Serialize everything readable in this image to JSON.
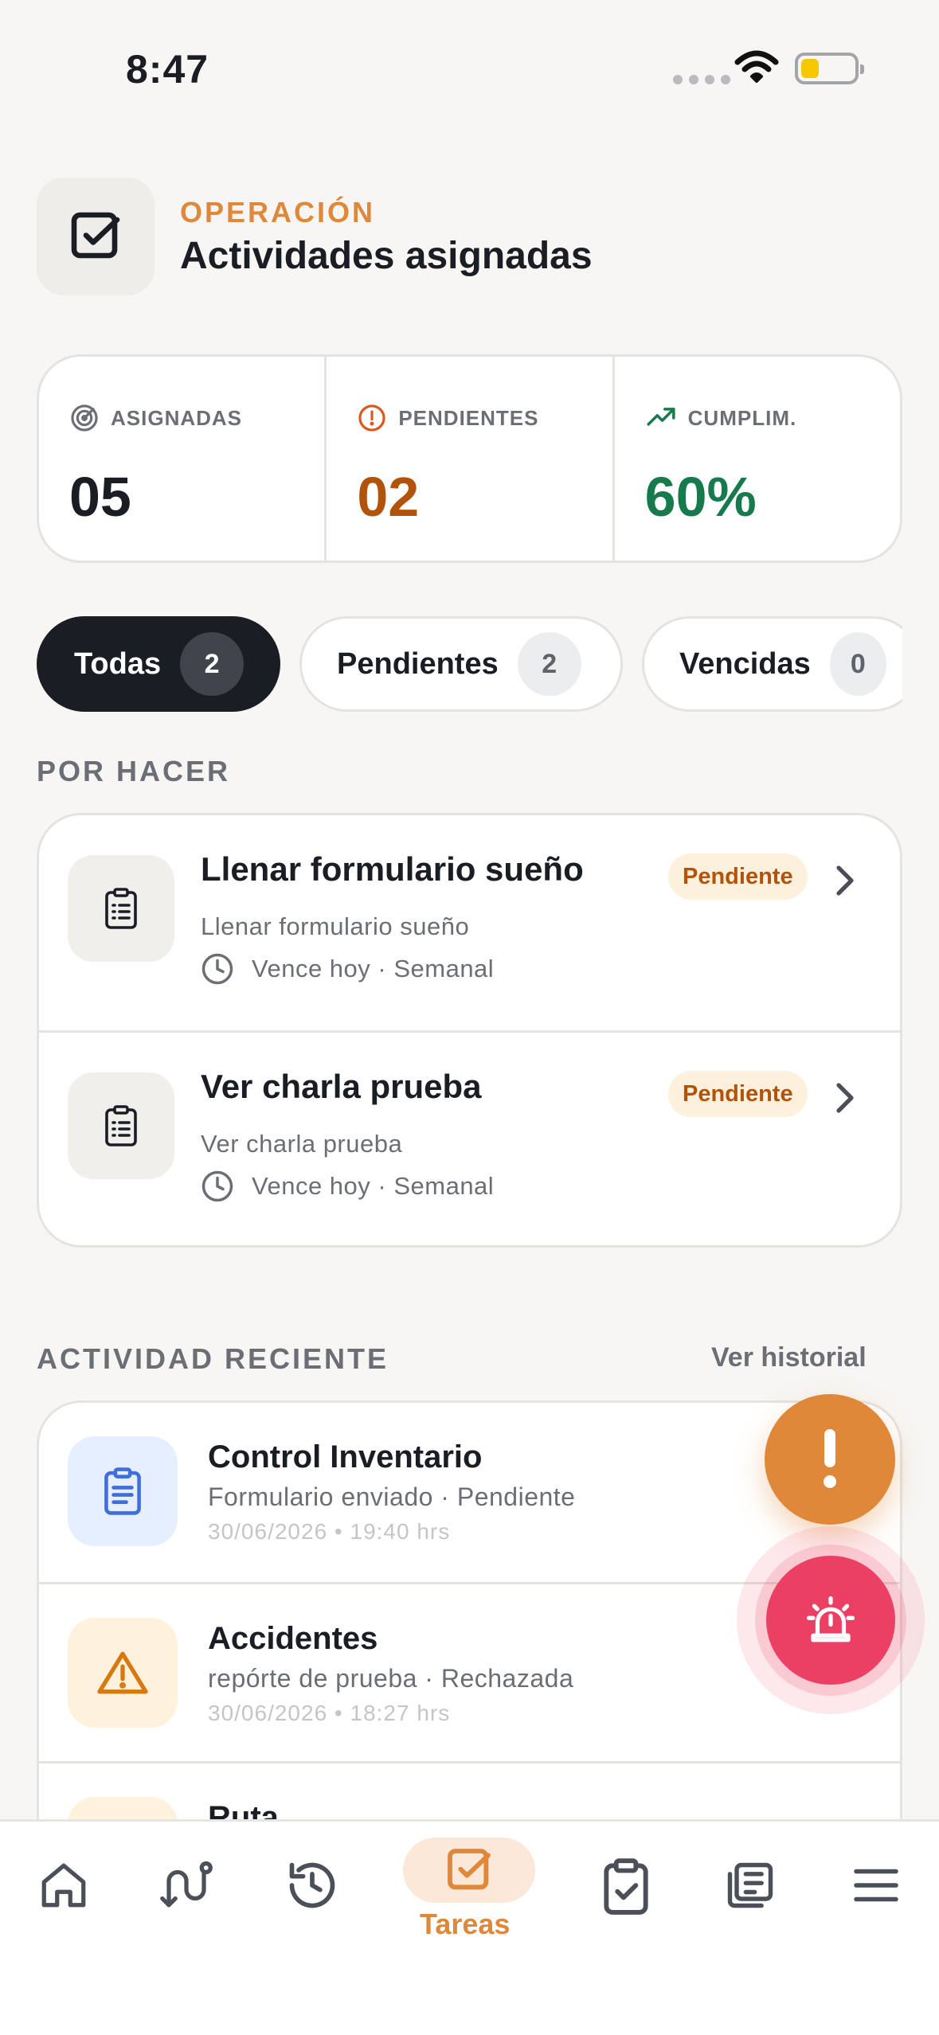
{
  "status_bar": {
    "time": "8:47"
  },
  "header": {
    "eyebrow": "OPERACIÓN",
    "title": "Actividades asignadas"
  },
  "stats": [
    {
      "label": "ASIGNADAS",
      "value": "05",
      "color": "#1a1d24",
      "icon": "target-icon"
    },
    {
      "label": "PENDIENTES",
      "value": "02",
      "color": "#b2530c",
      "icon": "alert-circle-icon"
    },
    {
      "label": "CUMPLIM.",
      "value": "60%",
      "color": "#177a4d",
      "icon": "trending-up-icon"
    }
  ],
  "tabs": [
    {
      "label": "Todas",
      "count": "2"
    },
    {
      "label": "Pendientes",
      "count": "2"
    },
    {
      "label": "Vencidas",
      "count": "0"
    }
  ],
  "todo": {
    "section_title": "POR HACER",
    "items": [
      {
        "title": "Llenar formulario sueño",
        "subtitle": "Llenar formulario sueño",
        "meta": "Vence hoy · Semanal",
        "badge": "Pendiente"
      },
      {
        "title": "Ver charla prueba",
        "subtitle": "Ver charla prueba",
        "meta": "Vence hoy · Semanal",
        "badge": "Pendiente"
      }
    ]
  },
  "recent": {
    "section_title": "ACTIVIDAD RECIENTE",
    "link": "Ver historial",
    "items": [
      {
        "title": "Control Inventario",
        "subtitle": "Formulario enviado · Pendiente",
        "date": "30/06/2026  •  19:40 hrs",
        "icon": "clipboard-list-icon"
      },
      {
        "title": "Accidentes",
        "subtitle": "repórte de prueba · Rechazada",
        "date": "30/06/2026  •  18:27 hrs",
        "icon": "warning-triangle-icon"
      },
      {
        "title": "Ruta",
        "subtitle": "",
        "date": "",
        "icon": "route-icon"
      }
    ]
  },
  "fab": {
    "alert_icon": "exclamation-icon",
    "alarm_icon": "siren-icon"
  },
  "bottom_nav": {
    "active": "Tareas",
    "items": [
      "home-icon",
      "route-icon",
      "history-icon",
      "tasks-icon",
      "clipboard-check-icon",
      "news-icon",
      "menu-icon"
    ]
  },
  "colors": {
    "accent": "#e0883a",
    "danger": "#ec3f64",
    "dark": "#1a1d24"
  }
}
